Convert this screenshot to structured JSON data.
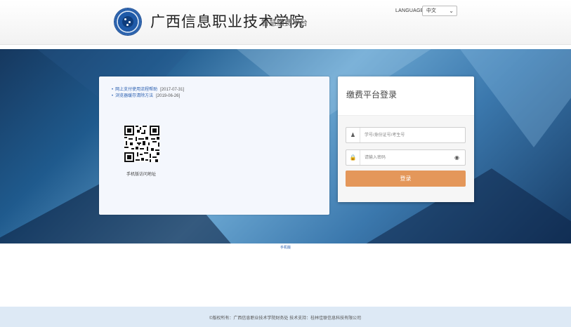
{
  "header": {
    "school_name": "广西信息职业技术学院",
    "subtitle": "智慧缴费平台",
    "language_label": "LANGUAGE",
    "language_selected": "中文"
  },
  "notices": [
    {
      "title": "网上支付使用流程帮助",
      "date": "[2017-07-31]"
    },
    {
      "title": "浏览器缓存清除方法",
      "date": "[2019-06-26]"
    }
  ],
  "qr": {
    "caption": "手机版访问地址"
  },
  "login": {
    "title": "缴费平台登录",
    "username_placeholder": "学号/身份证号/考生号",
    "password_placeholder": "请输入密码",
    "submit_label": "登录"
  },
  "mobile_link": "手机版",
  "footer": {
    "text": "©版权所有：广西信息职业技术学院财务处  技术支持：桂林佳联信息科技有限公司"
  },
  "colors": {
    "login_button": "#e4975a",
    "link": "#2a5fb0",
    "footer_bg": "#dde9f5"
  }
}
